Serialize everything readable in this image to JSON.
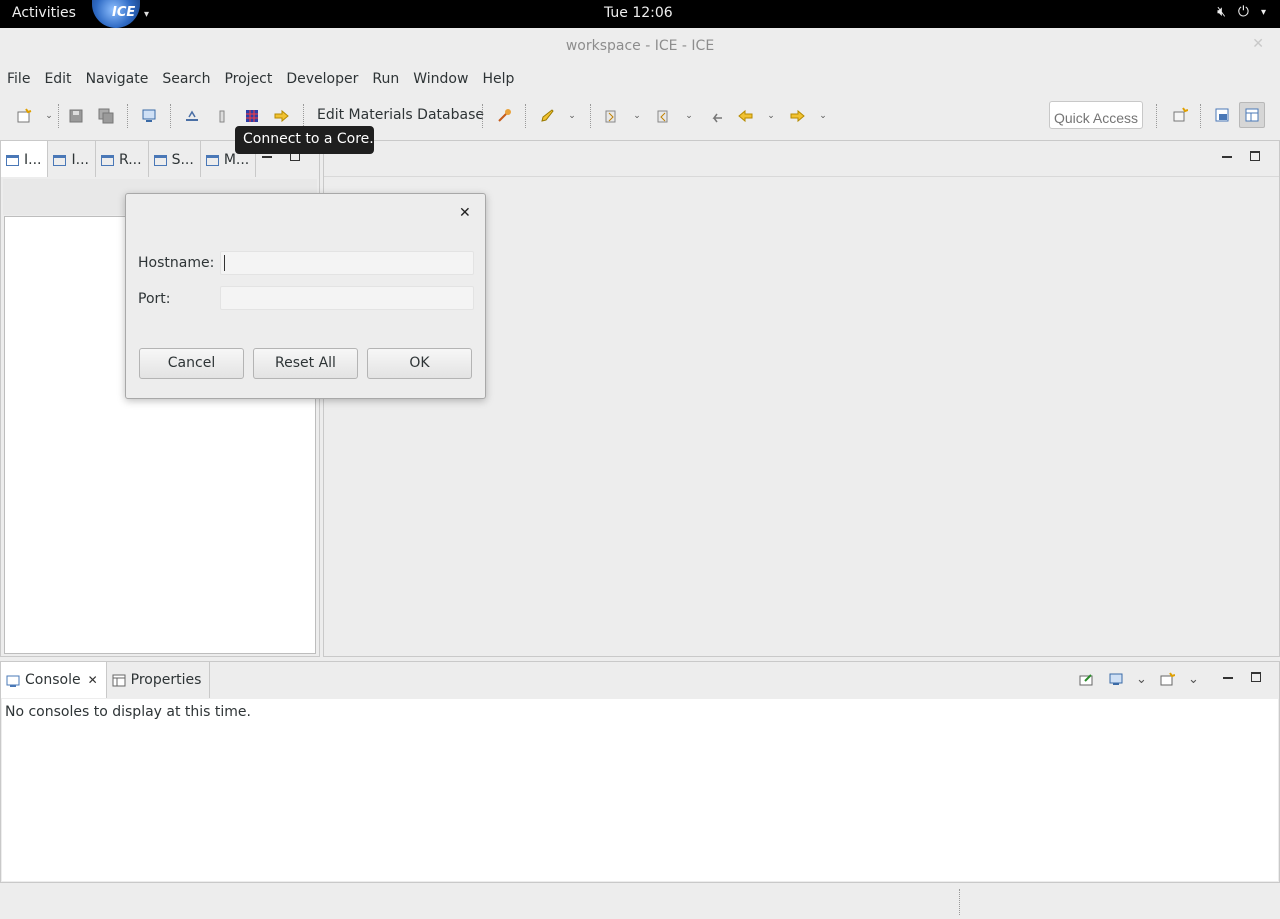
{
  "topbar": {
    "activities": "Activities",
    "app_name": "ICE",
    "clock": "Tue 12:06"
  },
  "window": {
    "title": "workspace - ICE - ICE"
  },
  "menu": [
    "File",
    "Edit",
    "Navigate",
    "Search",
    "Project",
    "Developer",
    "Run",
    "Window",
    "Help"
  ],
  "toolbar": {
    "edit_materials_label": "Edit Materials Database",
    "quick_access_placeholder": "Quick Access",
    "tooltip": "Connect to a Core."
  },
  "left_tabs": [
    "I...",
    "I...",
    "R...",
    "S...",
    "M..."
  ],
  "bottom": {
    "tabs": [
      "Console",
      "Properties"
    ],
    "message": "No consoles to display at this time."
  },
  "dialog": {
    "hostname_label": "Hostname:",
    "hostname_value": "",
    "port_label": "Port:",
    "port_value": "",
    "cancel": "Cancel",
    "reset_all": "Reset All",
    "ok": "OK"
  }
}
